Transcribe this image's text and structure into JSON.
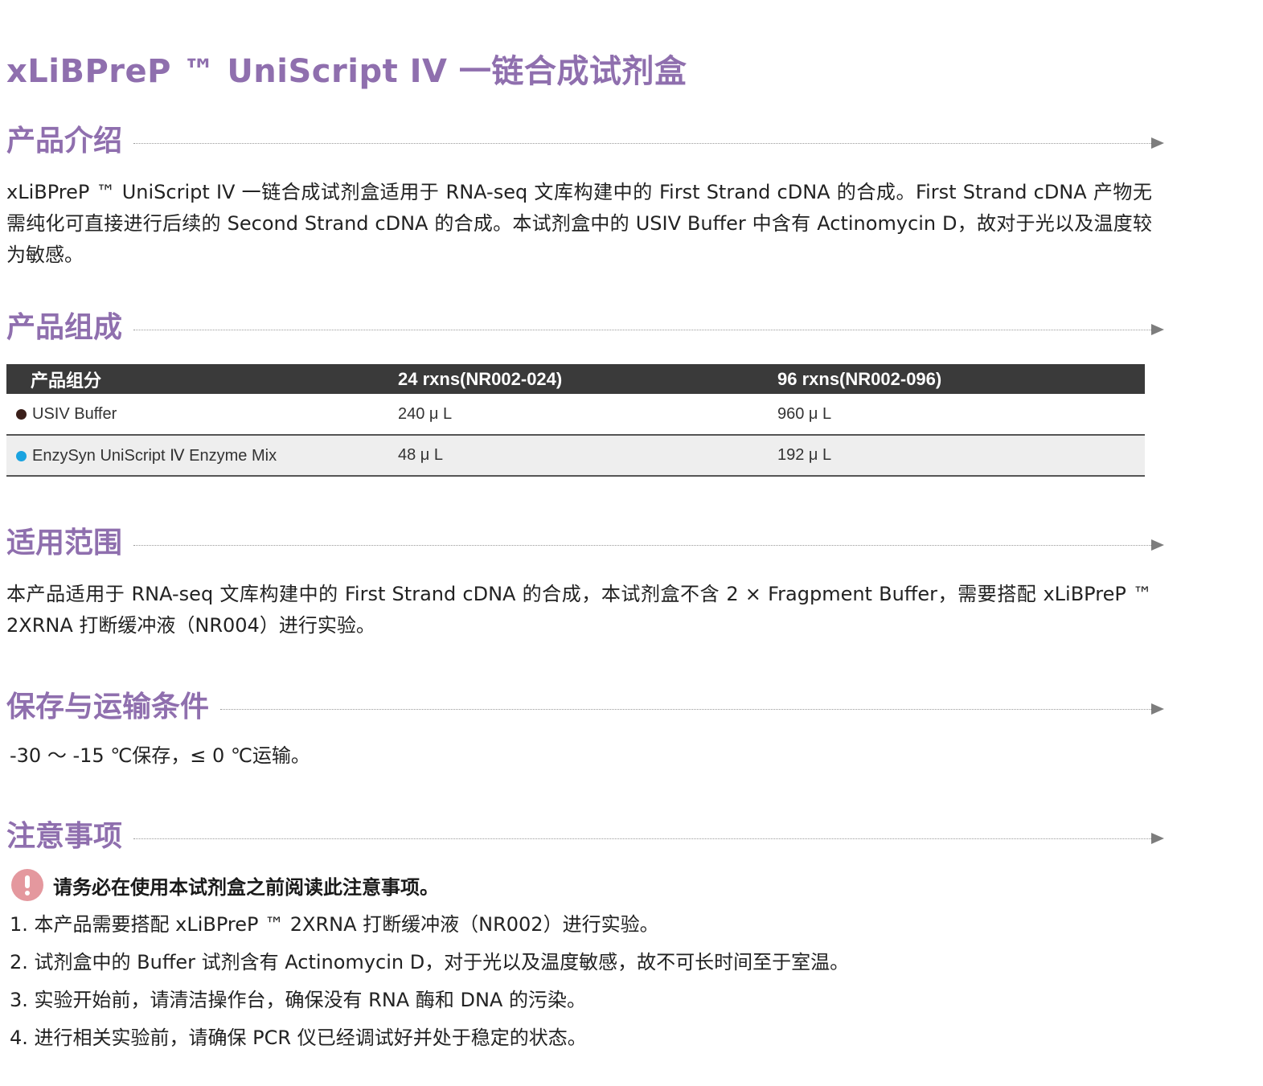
{
  "title": "xLiBPreP ™ UniScript IV 一链合成试剂盒",
  "sections": {
    "intro": {
      "heading": "产品介绍",
      "text": "xLiBPreP ™ UniScript IV 一链合成试剂盒适用于 RNA-seq 文库构建中的 First Strand cDNA 的合成。First Strand cDNA 产物无需纯化可直接进行后续的 Second Strand cDNA 的合成。本试剂盒中的 USIV Buffer 中含有 Actinomycin D，故对于光以及温度较为敏感。"
    },
    "composition": {
      "heading": "产品组成",
      "columns": [
        "产品组分",
        "24 rxns(NR002-024)",
        "96 rxns(NR002-096)"
      ],
      "rows": [
        {
          "name": "USIV Buffer",
          "dot_color": "#3b1f1a",
          "v24": "240 μ L",
          "v96": "960 μ L"
        },
        {
          "name": "EnzySyn UniScript Ⅳ Enzyme Mix",
          "dot_color": "#1aa3e0",
          "v24": "48 μ L",
          "v96": "192 μ L"
        }
      ]
    },
    "scope": {
      "heading": "适用范围",
      "text": "本产品适用于 RNA-seq 文库构建中的 First Strand cDNA 的合成，本试剂盒不含 2 × Fragpment Buffer，需要搭配 xLiBPreP ™ 2XRNA 打断缓冲液（NR004）进行实验。"
    },
    "storage": {
      "heading": "保存与运输条件",
      "text": "-30 ～ -15 ℃保存，≤ 0 ℃运输。"
    },
    "notes": {
      "heading": "注意事项",
      "warning": "请务必在使用本试剂盒之前阅读此注意事项。",
      "items": [
        "1. 本产品需要搭配 xLiBPreP ™ 2XRNA 打断缓冲液（NR002）进行实验。",
        "2. 试剂盒中的 Buffer 试剂含有 Actinomycin D，对于光以及温度敏感，故不可长时间至于室温。",
        "3. 实验开始前，请清洁操作台，确保没有 RNA 酶和 DNA 的污染。",
        "4. 进行相关实验前，请确保 PCR 仪已经调试好并处于稳定的状态。"
      ]
    }
  },
  "colors": {
    "accent": "#8f6fae",
    "table_header": "#3a3a3a",
    "warning_icon": "#e4989e"
  }
}
